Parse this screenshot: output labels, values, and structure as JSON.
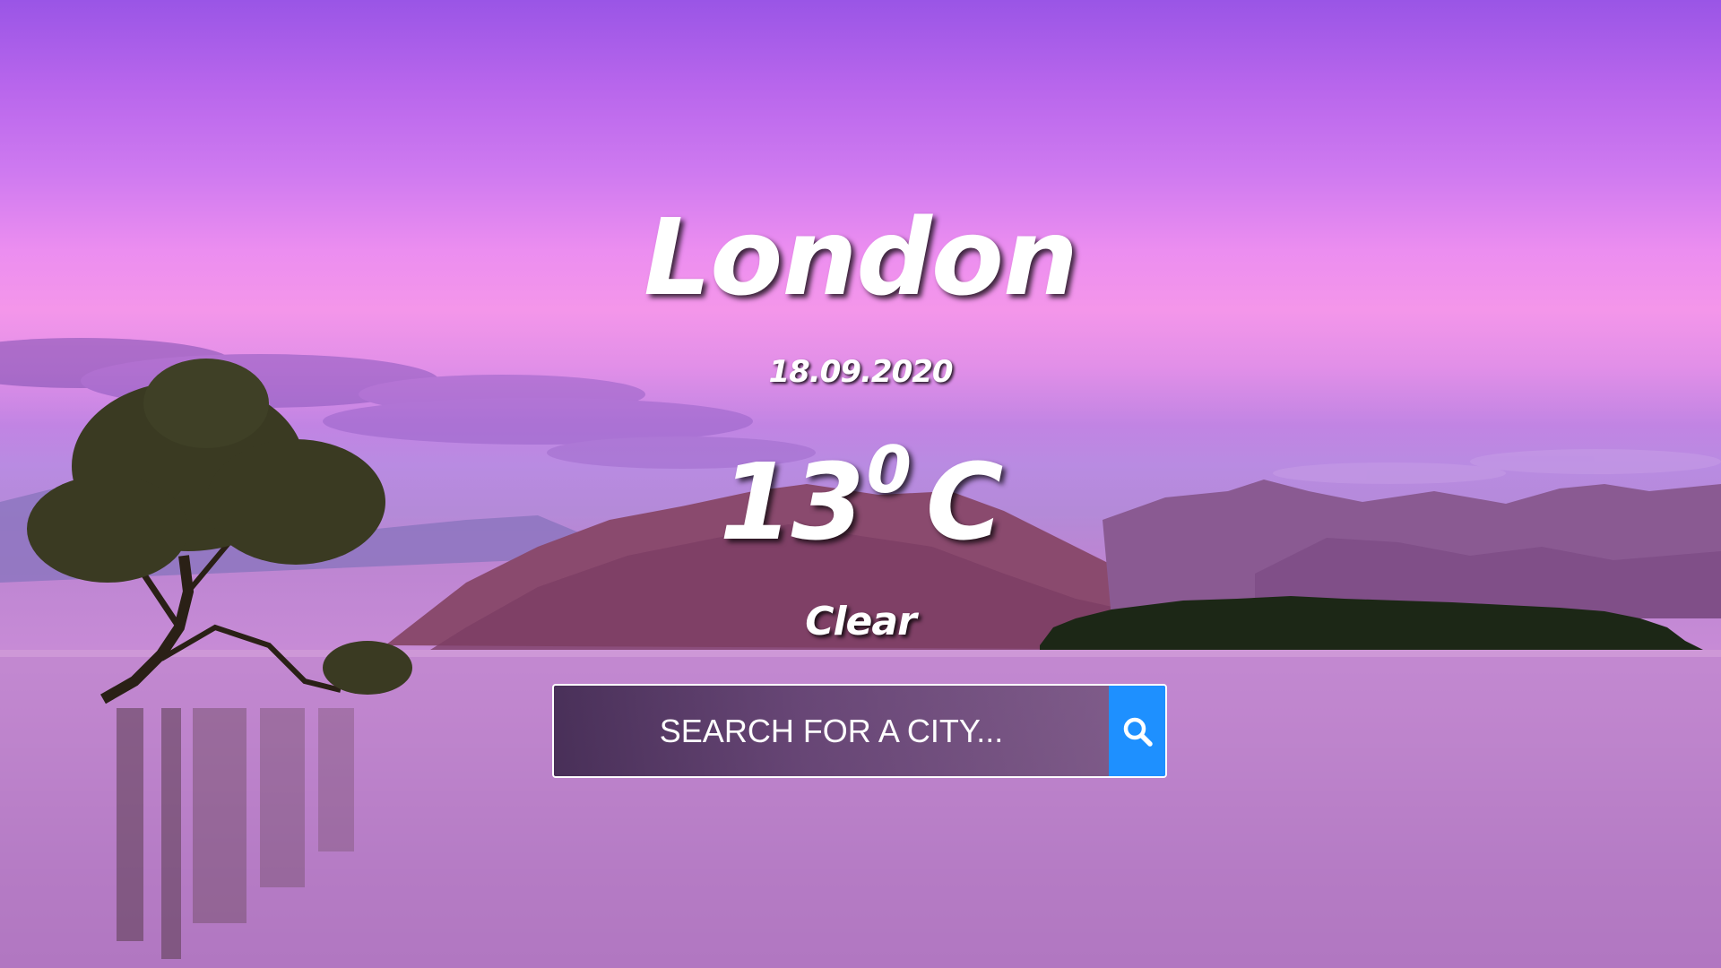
{
  "weather": {
    "city": "London",
    "date": "18.09.2020",
    "temperature": "13",
    "degree_symbol": "0",
    "unit": "C",
    "condition": "Clear"
  },
  "search": {
    "placeholder": "SEARCH FOR A CITY...",
    "button_icon": "search-icon",
    "button_color": "#1e90ff"
  },
  "background": {
    "description_icon": "lake-landscape-image",
    "accent_colors": [
      "#9a55e6",
      "#f496ea",
      "#c286d2"
    ]
  }
}
